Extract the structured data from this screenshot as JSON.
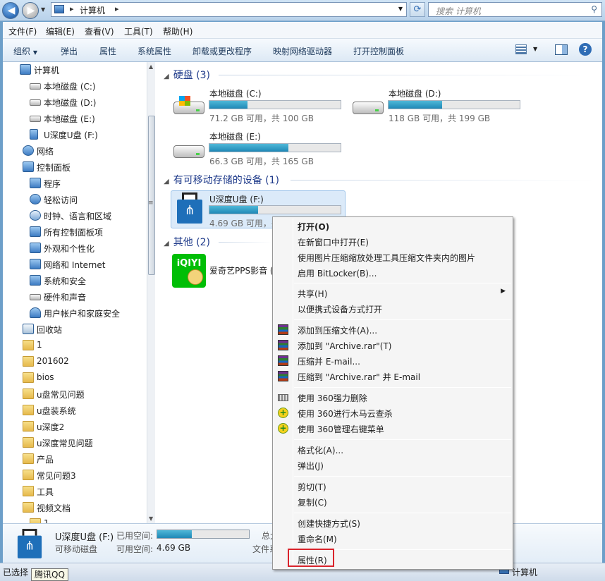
{
  "addressbar": {
    "path": "计算机",
    "search_placeholder": "搜索 计算机"
  },
  "menubar": {
    "items": [
      "文件(F)",
      "编辑(E)",
      "查看(V)",
      "工具(T)",
      "帮助(H)"
    ]
  },
  "commandbar": {
    "items": [
      "组织",
      "弹出",
      "属性",
      "系统属性",
      "卸载或更改程序",
      "映射网络驱动器",
      "打开控制面板"
    ]
  },
  "nav": {
    "items": [
      {
        "label": "计算机"
      },
      {
        "label": "本地磁盘 (C:)"
      },
      {
        "label": "本地磁盘 (D:)"
      },
      {
        "label": "本地磁盘 (E:)"
      },
      {
        "label": "U深度U盘 (F:)"
      },
      {
        "label": "网络"
      },
      {
        "label": "控制面板"
      },
      {
        "label": "程序"
      },
      {
        "label": "轻松访问"
      },
      {
        "label": "时钟、语言和区域"
      },
      {
        "label": "所有控制面板项"
      },
      {
        "label": "外观和个性化"
      },
      {
        "label": "网络和 Internet"
      },
      {
        "label": "系统和安全"
      },
      {
        "label": "硬件和声音"
      },
      {
        "label": "用户帐户和家庭安全"
      },
      {
        "label": "回收站"
      },
      {
        "label": "1"
      },
      {
        "label": "201602"
      },
      {
        "label": "bios"
      },
      {
        "label": "u盘常见问题"
      },
      {
        "label": "u盘装系统"
      },
      {
        "label": "u深度2"
      },
      {
        "label": "u深度常见问题"
      },
      {
        "label": "产品"
      },
      {
        "label": "常见问题3"
      },
      {
        "label": "工具"
      },
      {
        "label": "视频文档"
      },
      {
        "label": "1"
      }
    ]
  },
  "content": {
    "groups": {
      "hdd": "硬盘 (3)",
      "removable": "有可移动存储的设备 (1)",
      "other": "其他 (2)"
    },
    "drives": [
      {
        "name": "本地磁盘 (C:)",
        "size": "71.2 GB 可用，共 100 GB",
        "used_fraction": 0.29
      },
      {
        "name": "本地磁盘 (D:)",
        "size": "118 GB 可用，共 199 GB",
        "used_fraction": 0.41
      },
      {
        "name": "本地磁盘 (E:)",
        "size": "66.3 GB 可用，共 165 GB",
        "used_fraction": 0.6
      }
    ],
    "usb": {
      "name": "U深度U盘 (F:)",
      "size": "4.69 GB 可用，共",
      "used_fraction": 0.37
    },
    "other": {
      "name": "爱奇艺PPS影音 (",
      "logo": "iQIYI"
    }
  },
  "contextmenu": {
    "items": [
      {
        "label": "打开(O)"
      },
      {
        "label": "在新窗口中打开(E)"
      },
      {
        "label": "使用图片压缩缩放处理工具压缩文件夹内的图片"
      },
      {
        "label": "启用 BitLocker(B)..."
      },
      {
        "label": "共享(H)"
      },
      {
        "label": "以便携式设备方式打开"
      },
      {
        "label": "添加到压缩文件(A)..."
      },
      {
        "label": "添加到 \"Archive.rar\"(T)"
      },
      {
        "label": "压缩并 E-mail..."
      },
      {
        "label": "压缩到 \"Archive.rar\" 并 E-mail"
      },
      {
        "label": "使用 360强力删除"
      },
      {
        "label": "使用 360进行木马云查杀"
      },
      {
        "label": "使用 360管理右键菜单"
      },
      {
        "label": "格式化(A)..."
      },
      {
        "label": "弹出(J)"
      },
      {
        "label": "剪切(T)"
      },
      {
        "label": "复制(C)"
      },
      {
        "label": "创建快捷方式(S)"
      },
      {
        "label": "重命名(M)"
      },
      {
        "label": "属性(R)"
      }
    ]
  },
  "details": {
    "name": "U深度U盘 (F:)",
    "type": "可移动磁盘",
    "used_label": "已用空间:",
    "free_label": "可用空间:",
    "free_value": "4.69 GB",
    "total_label": "总大",
    "fs_label": "文件系",
    "used_fraction": 0.38
  },
  "status": {
    "left": "已选择",
    "right": "计算机",
    "tooltip": "腾讯QQ"
  },
  "colors": {
    "accent": "#1f88b6",
    "highlight_box": "#d9232b",
    "selected": "#dbeaf9"
  }
}
